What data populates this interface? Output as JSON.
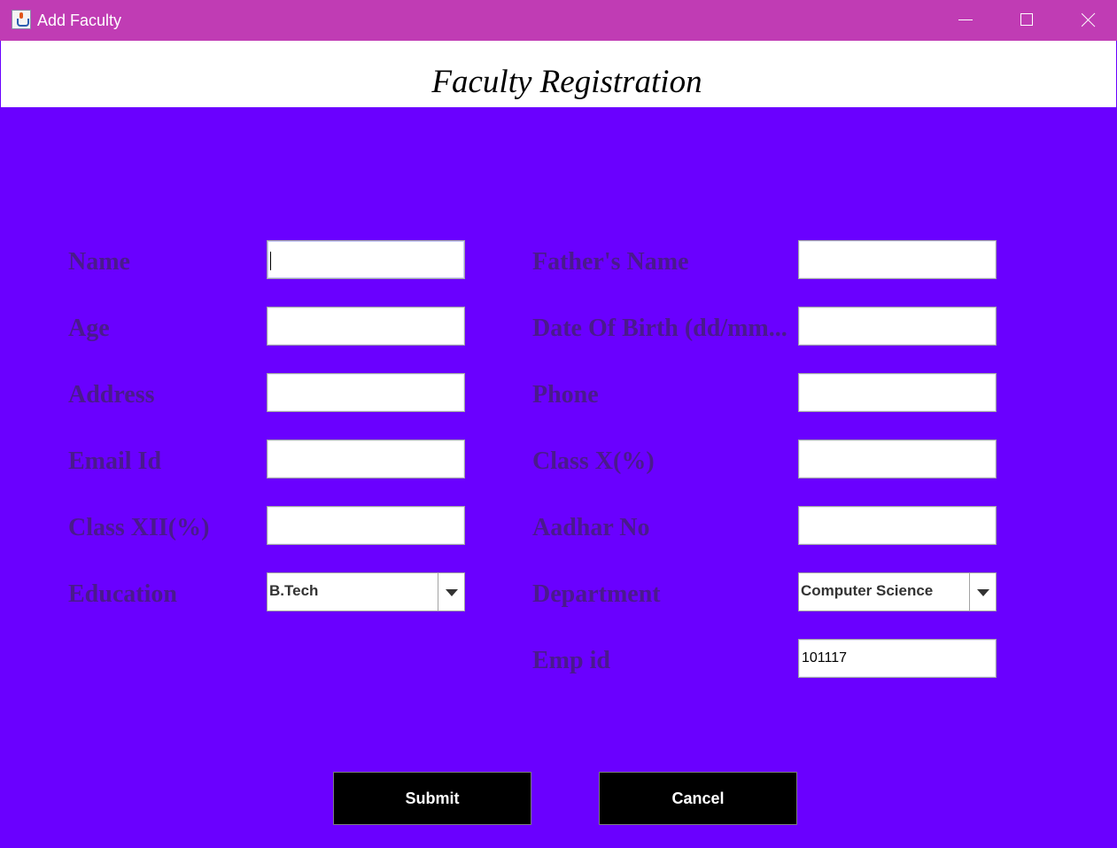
{
  "window": {
    "title": "Add Faculty",
    "icon": "java-cup-icon",
    "controls": {
      "minimize": "minimize-icon",
      "maximize": "maximize-icon",
      "close": "close-icon"
    }
  },
  "header": {
    "title": "Faculty Registration"
  },
  "form": {
    "left": {
      "name_label": "Name",
      "age_label": "Age",
      "address_label": "Address",
      "email_label": "Email Id",
      "class12_label": "Class XII(%)",
      "education_label": "Education",
      "education_value": "B.Tech"
    },
    "right": {
      "father_label": "Father's Name",
      "dob_label": "Date Of Birth (dd/mm...",
      "phone_label": "Phone",
      "class10_label": "Class X(%)",
      "aadhar_label": "Aadhar No",
      "department_label": "Department",
      "department_value": "Computer Science",
      "empid_label": "Emp id",
      "empid_value": "101117"
    }
  },
  "buttons": {
    "submit": "Submit",
    "cancel": "Cancel"
  },
  "colors": {
    "titlebar": "#c03cb4",
    "background": "#6a00ff",
    "label": "#4a1a8c",
    "button": "#000000"
  }
}
